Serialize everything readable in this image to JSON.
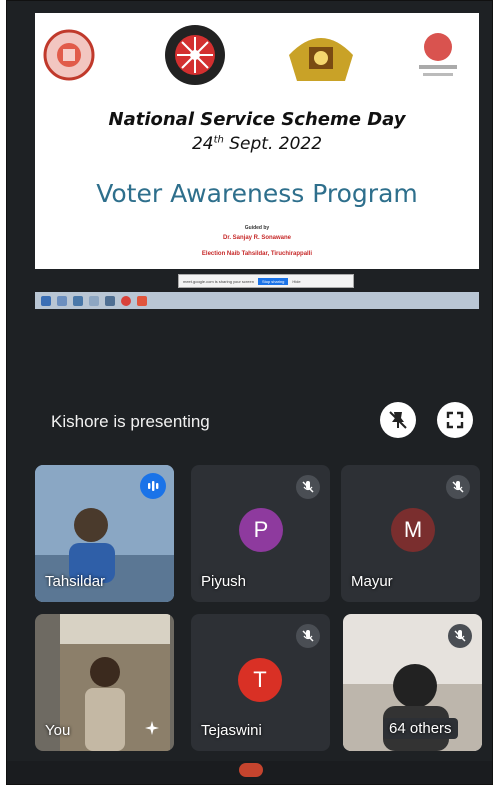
{
  "slide": {
    "title": "National Service Scheme Day",
    "date_prefix": "24",
    "date_sup": "th",
    "date_suffix": " Sept. 2022",
    "program": "Voter Awareness Program",
    "guided_by": "Guided by",
    "speaker": "Dr. Sanjay R. Sonawane",
    "speaker_role": "Election Naib Tahsildar, Tiruchirappalli"
  },
  "share_bar": {
    "text": "meet.google.com is sharing your screen",
    "stop_label": "Stop sharing",
    "hide_label": "Hide"
  },
  "presenting": {
    "label": "Kishore is presenting"
  },
  "participants": [
    {
      "name": "Tahsildar",
      "type": "video"
    },
    {
      "name": "Piyush",
      "initial": "P",
      "avatar_color": "#8e3a9e",
      "type": "avatar"
    },
    {
      "name": "Mayur",
      "initial": "M",
      "avatar_color": "#7a2e2e",
      "type": "avatar"
    },
    {
      "name": "You",
      "type": "video"
    },
    {
      "name": "Tejaswini",
      "initial": "T",
      "avatar_color": "#d93025",
      "type": "avatar"
    },
    {
      "name": "64 others",
      "type": "video"
    }
  ],
  "colors": {
    "background": "#1e2124",
    "tile": "#2d3035",
    "accent": "#1a73e8",
    "program_text": "#2e6f8c"
  }
}
